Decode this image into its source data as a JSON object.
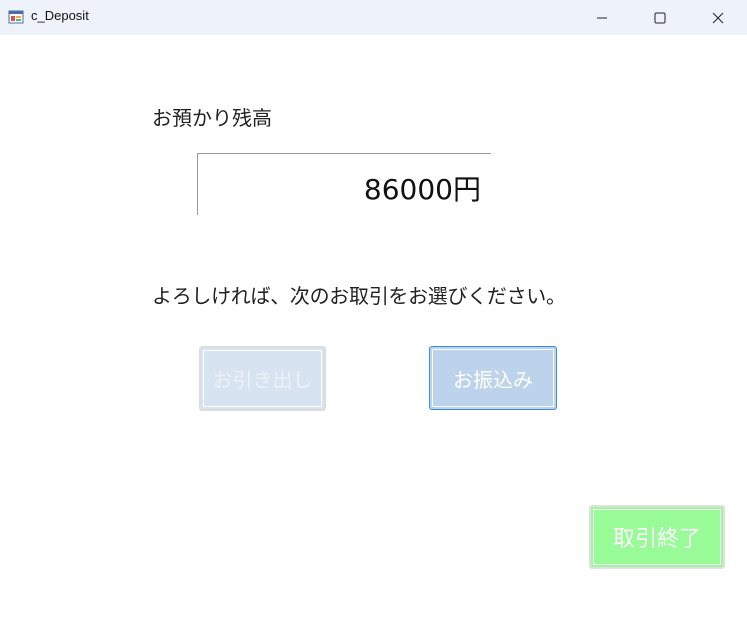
{
  "window": {
    "title": "c_Deposit",
    "icon": "winforms-app-icon",
    "controls": [
      "minimize-icon",
      "maximize-icon",
      "close-icon"
    ]
  },
  "balance": {
    "label": "お預かり残高",
    "value": "86000円"
  },
  "prompt": "よろしければ、次のお取引をお選びください。",
  "buttons": {
    "withdraw": "お引き出し",
    "transfer": "お振込み",
    "end": "取引終了"
  },
  "colors": {
    "titlebar": "#eef2f9",
    "withdraw_bg": "#d7e3f1",
    "transfer_bg": "#bdd3eb",
    "transfer_border": "#3c8ddb",
    "end_bg": "#98fb98"
  }
}
